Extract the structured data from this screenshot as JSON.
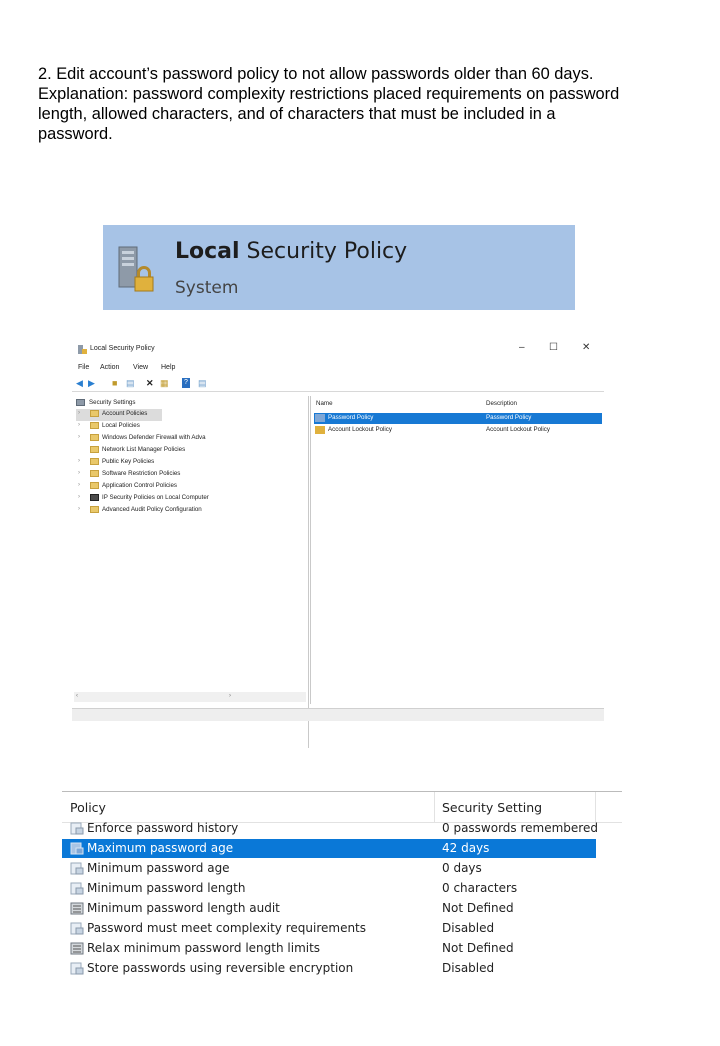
{
  "instructions": {
    "line1": "2.  Edit account’s password policy to not allow passwords older than 60 days.",
    "line2": "Explanation: password complexity restrictions placed requirements on password",
    "line3": "length, allowed characters, and of characters that must be included in a",
    "line4": "password."
  },
  "search_result": {
    "title_bold": "Local",
    "title_rest": " Security Policy",
    "subtitle": "System",
    "icon": "server-lock-icon"
  },
  "window": {
    "title": "Local Security Policy",
    "controls": {
      "minimize": "–",
      "maximize": "☐",
      "close": "✕"
    },
    "menu": [
      "File",
      "Action",
      "View",
      "Help"
    ],
    "tree": [
      "Security Settings",
      "Account Policies",
      "Local Policies",
      "Windows Defender Firewall with Adva",
      "Network List Manager Policies",
      "Public Key Policies",
      "Software Restriction Policies",
      "Application Control Policies",
      "IP Security Policies on Local Computer",
      "Advanced Audit Policy Configuration"
    ],
    "list_headers": {
      "name": "Name",
      "description": "Description"
    },
    "list_rows": [
      {
        "name": "Password Policy",
        "description": "Password Policy"
      },
      {
        "name": "Account Lockout Policy",
        "description": "Account Lockout Policy"
      }
    ],
    "selected_color": "#1779d4"
  },
  "policy_table": {
    "headers": {
      "policy": "Policy",
      "setting": "Security Setting"
    },
    "rows": [
      {
        "policy": "Enforce password history",
        "setting": "0 passwords remembered"
      },
      {
        "policy": "Maximum password age",
        "setting": "42 days"
      },
      {
        "policy": "Minimum password age",
        "setting": "0 days"
      },
      {
        "policy": "Minimum password length",
        "setting": "0 characters"
      },
      {
        "policy": "Minimum password length audit",
        "setting": "Not Defined"
      },
      {
        "policy": "Password must meet complexity requirements",
        "setting": "Disabled"
      },
      {
        "policy": "Relax minimum password length limits",
        "setting": "Not Defined"
      },
      {
        "policy": "Store passwords using reversible encryption",
        "setting": "Disabled"
      }
    ],
    "selected_color": "#0a78d7"
  }
}
